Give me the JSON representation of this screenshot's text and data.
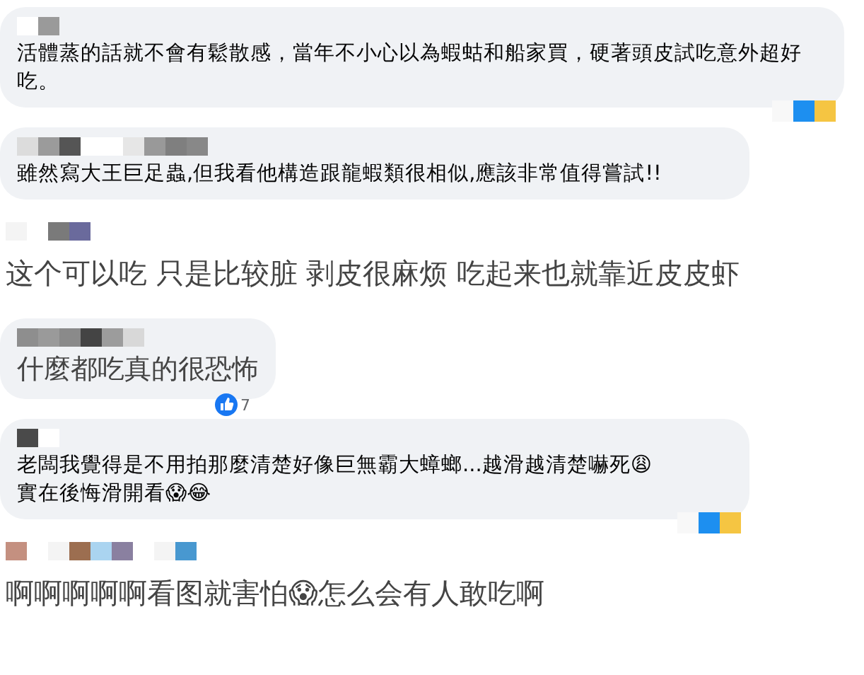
{
  "comments": [
    {
      "kind": "bubble",
      "text": "活體蒸的話就不會有鬆散感，當年不小心以為蝦蛄和船家買，硬著頭皮試吃意外超好吃。",
      "reactions": true
    },
    {
      "kind": "bubble",
      "text": "雖然寫大王巨足蟲,但我看他構造跟龍蝦類很相似,應該非常值得嘗試!!",
      "reactions": false
    },
    {
      "kind": "plain",
      "text": "这个可以吃 只是比较脏 剥皮很麻烦 吃起来也就靠近皮皮虾",
      "reactions": false
    },
    {
      "kind": "bubble-large",
      "text": "什麼都吃真的很恐怖",
      "reactions": false,
      "like_count": "7"
    },
    {
      "kind": "bubble",
      "text": "老闆我覺得是不用拍那麼清楚好像巨無霸大蟑螂...越滑越清楚嚇死😩\n實在後悔滑開看😱😂",
      "reactions": true
    },
    {
      "kind": "plain",
      "text": "啊啊啊啊啊看图就害怕😱怎么会有人敢吃啊",
      "reactions": false
    }
  ]
}
